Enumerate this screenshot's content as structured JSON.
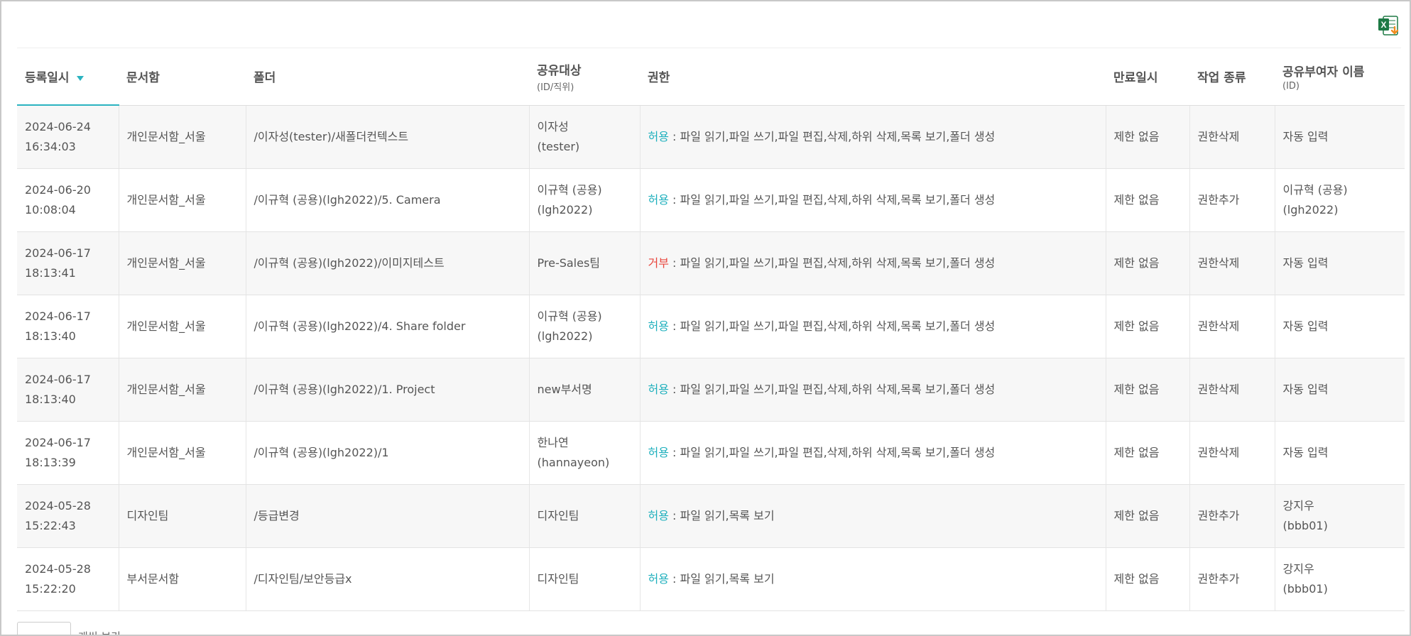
{
  "toolbar": {
    "excel_icon": "excel-download-icon"
  },
  "columns": [
    {
      "label": "등록일시",
      "sub": ""
    },
    {
      "label": "문서함",
      "sub": ""
    },
    {
      "label": "폴더",
      "sub": ""
    },
    {
      "label": "공유대상",
      "sub": "(ID/직위)"
    },
    {
      "label": "권한",
      "sub": ""
    },
    {
      "label": "만료일시",
      "sub": ""
    },
    {
      "label": "작업 종류",
      "sub": ""
    },
    {
      "label": "공유부여자 이름",
      "sub": "(ID)"
    }
  ],
  "rows": [
    {
      "date": "2024-06-24",
      "time": "16:34:03",
      "box": "개인문서함_서울",
      "folder": "/이자성(tester)/새폴더컨텍스트",
      "target1": "이자성",
      "target2": "(tester)",
      "perm_type": "허용",
      "perm_kind": "allow",
      "perm_list": " : 파일 읽기,파일 쓰기,파일 편집,삭제,하위 삭제,목록 보기,폴더 생성",
      "expire": "제한 없음",
      "action": "권한삭제",
      "granter1": "자동 입력",
      "granter2": ""
    },
    {
      "date": "2024-06-20",
      "time": "10:08:04",
      "box": "개인문서함_서울",
      "folder": "/이규혁 (공용)(lgh2022)/5. Camera",
      "target1": "이규혁 (공용)",
      "target2": "(lgh2022)",
      "perm_type": "허용",
      "perm_kind": "allow",
      "perm_list": " : 파일 읽기,파일 쓰기,파일 편집,삭제,하위 삭제,목록 보기,폴더 생성",
      "expire": "제한 없음",
      "action": "권한추가",
      "granter1": "이규혁 (공용)",
      "granter2": "(lgh2022)"
    },
    {
      "date": "2024-06-17",
      "time": "18:13:41",
      "box": "개인문서함_서울",
      "folder": "/이규혁 (공용)(lgh2022)/이미지테스트",
      "target1": "Pre-Sales팀",
      "target2": "",
      "perm_type": "거부",
      "perm_kind": "deny",
      "perm_list": " : 파일 읽기,파일 쓰기,파일 편집,삭제,하위 삭제,목록 보기,폴더 생성",
      "expire": "제한 없음",
      "action": "권한삭제",
      "granter1": "자동 입력",
      "granter2": ""
    },
    {
      "date": "2024-06-17",
      "time": "18:13:40",
      "box": "개인문서함_서울",
      "folder": "/이규혁 (공용)(lgh2022)/4. Share folder",
      "target1": "이규혁 (공용)",
      "target2": "(lgh2022)",
      "perm_type": "허용",
      "perm_kind": "allow",
      "perm_list": " : 파일 읽기,파일 쓰기,파일 편집,삭제,하위 삭제,목록 보기,폴더 생성",
      "expire": "제한 없음",
      "action": "권한삭제",
      "granter1": "자동 입력",
      "granter2": ""
    },
    {
      "date": "2024-06-17",
      "time": "18:13:40",
      "box": "개인문서함_서울",
      "folder": "/이규혁 (공용)(lgh2022)/1. Project",
      "target1": "new부서명",
      "target2": "",
      "perm_type": "허용",
      "perm_kind": "allow",
      "perm_list": " : 파일 읽기,파일 쓰기,파일 편집,삭제,하위 삭제,목록 보기,폴더 생성",
      "expire": "제한 없음",
      "action": "권한삭제",
      "granter1": "자동 입력",
      "granter2": ""
    },
    {
      "date": "2024-06-17",
      "time": "18:13:39",
      "box": "개인문서함_서울",
      "folder": "/이규혁 (공용)(lgh2022)/1",
      "target1": "한나연",
      "target2": "(hannayeon)",
      "perm_type": "허용",
      "perm_kind": "allow",
      "perm_list": " : 파일 읽기,파일 쓰기,파일 편집,삭제,하위 삭제,목록 보기,폴더 생성",
      "expire": "제한 없음",
      "action": "권한삭제",
      "granter1": "자동 입력",
      "granter2": ""
    },
    {
      "date": "2024-05-28",
      "time": "15:22:43",
      "box": "디자인팀",
      "folder": "/등급변경",
      "target1": "디자인팀",
      "target2": "",
      "perm_type": "허용",
      "perm_kind": "allow",
      "perm_list": " : 파일 읽기,목록 보기",
      "expire": "제한 없음",
      "action": "권한추가",
      "granter1": "강지우",
      "granter2": "(bbb01)"
    },
    {
      "date": "2024-05-28",
      "time": "15:22:20",
      "box": "부서문서함",
      "folder": "/디자인팀/보안등급x",
      "target1": "디자인팀",
      "target2": "",
      "perm_type": "허용",
      "perm_kind": "allow",
      "perm_list": " : 파일 읽기,목록 보기",
      "expire": "제한 없음",
      "action": "권한추가",
      "granter1": "강지우",
      "granter2": "(bbb01)"
    }
  ],
  "footer": {
    "page_size_label": "개씩 보기"
  },
  "colors": {
    "allow": "#1fb0bd",
    "deny": "#e8453c",
    "sort_accent": "#2bb3c0"
  }
}
